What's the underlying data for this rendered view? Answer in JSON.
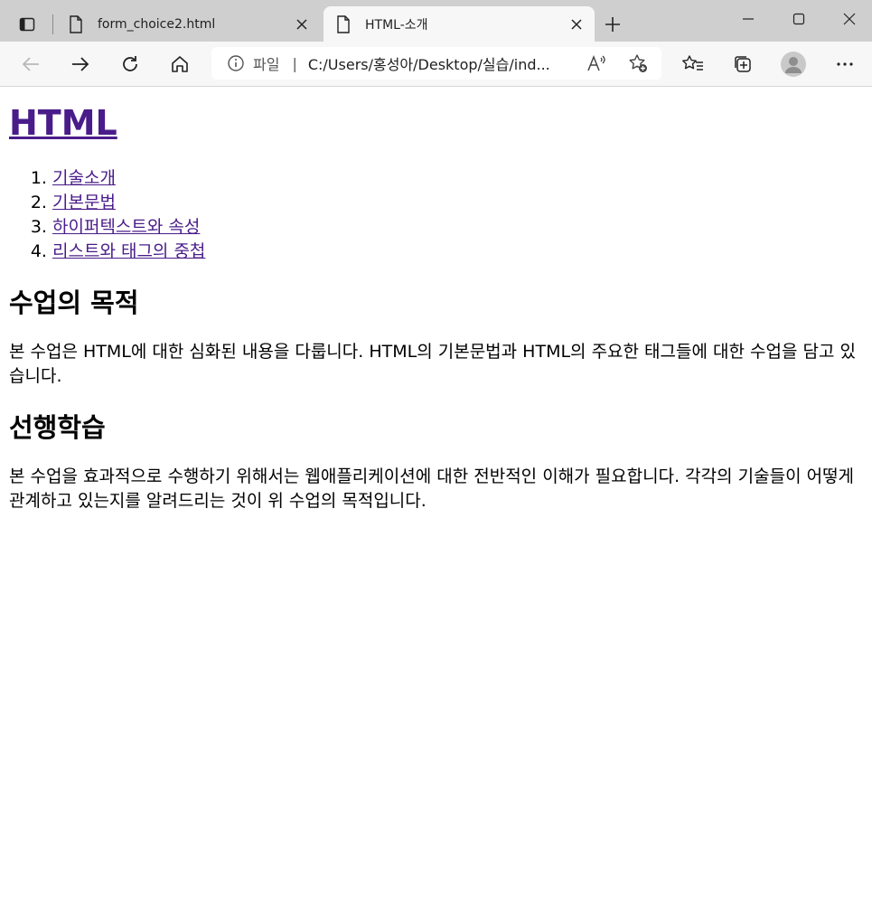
{
  "tabs": [
    {
      "title": "form_choice2.html",
      "icon": "document-icon",
      "active": false
    },
    {
      "title": "HTML-소개",
      "icon": "document-icon",
      "active": true
    }
  ],
  "address_bar": {
    "scheme_label": "파일",
    "separator": "|",
    "url": "C:/Users/홍성아/Desktop/실습/ind..."
  },
  "page": {
    "heading": "HTML",
    "toc": [
      "기술소개",
      "기본문법",
      "하이퍼텍스트와 속성",
      "리스트와 태그의 중첩"
    ],
    "sections": [
      {
        "title": "수업의 목적",
        "body": "본 수업은 HTML에 대한 심화된 내용을 다룹니다. HTML의 기본문법과 HTML의 주요한 태그들에 대한 수업을 담고 있습니다."
      },
      {
        "title": "선행학습",
        "body": "본 수업을 효과적으로 수행하기 위해서는 웹애플리케이션에 대한 전반적인 이해가 필요합니다. 각각의 기술들이 어떻게 관계하고 있는지를 알려드리는 것이 위 수업의 목적입니다."
      }
    ]
  },
  "colors": {
    "link": "#4a1c8a",
    "tabstrip": "#cfcfcf",
    "toolbar": "#f7f7f7"
  }
}
